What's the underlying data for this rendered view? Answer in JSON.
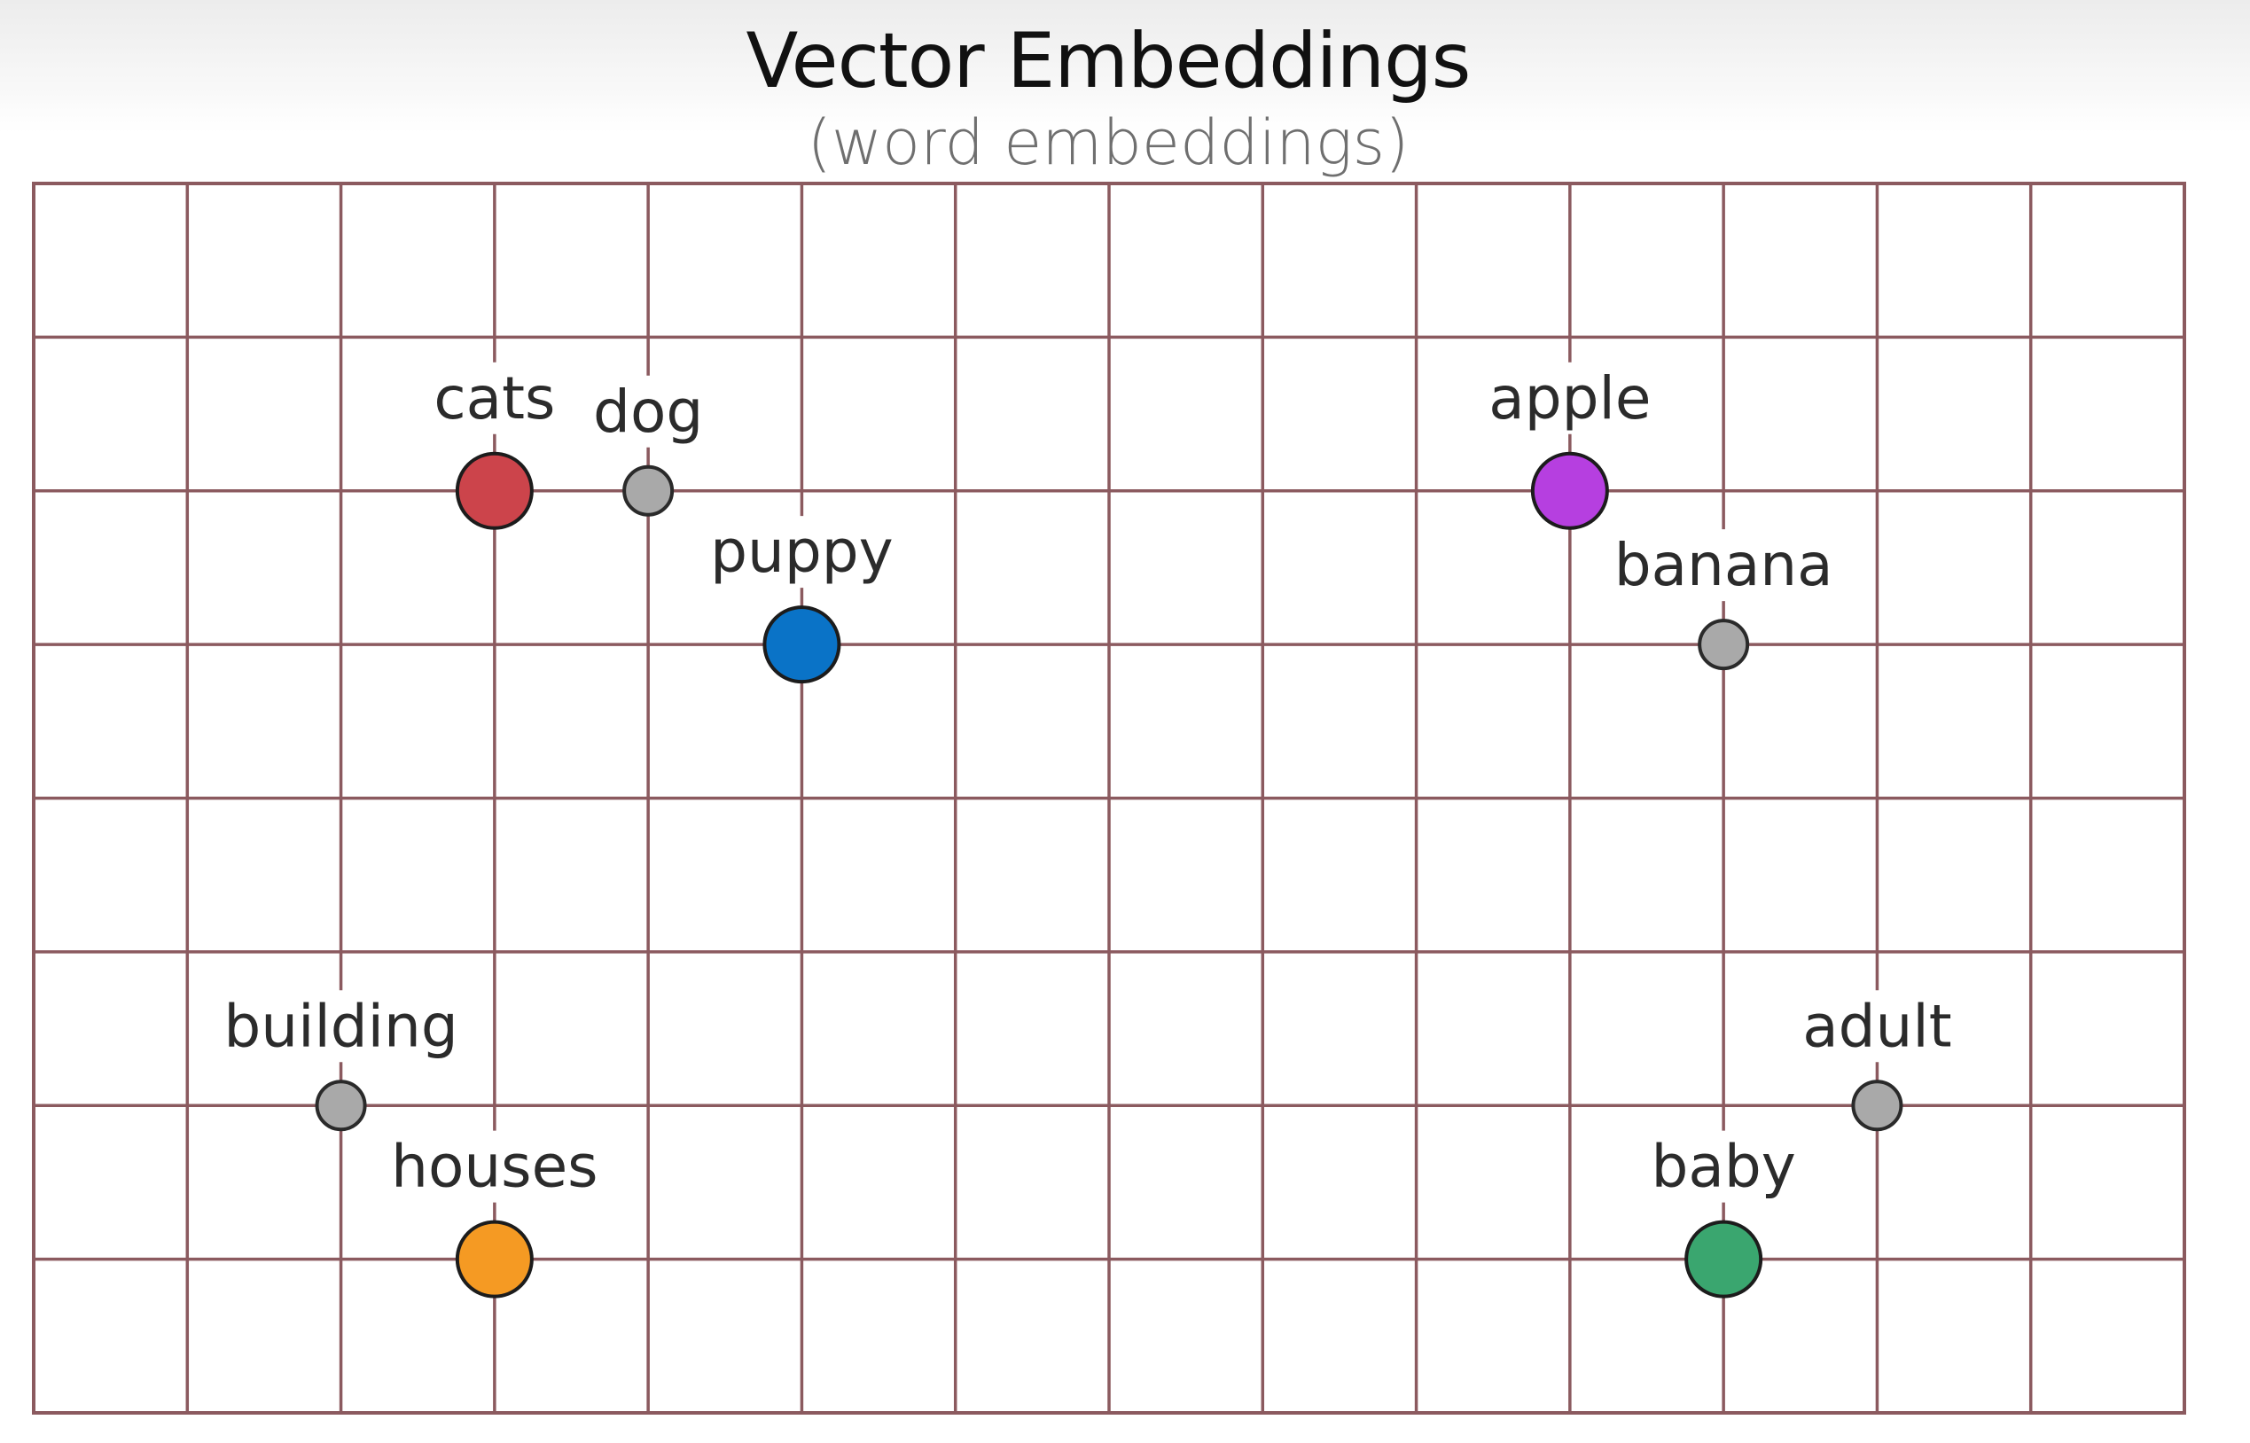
{
  "title": "Vector Embeddings",
  "subtitle": "(word embeddings)",
  "grid": {
    "columns": 14,
    "rows": 8,
    "line_color": "#8b5a5f",
    "background": "#ffffff"
  },
  "points": [
    {
      "id": "cats",
      "label": "cats",
      "col": 3,
      "row": 2,
      "size": "large",
      "color": "#cc444b",
      "stroke": "#1c1c1c"
    },
    {
      "id": "dog",
      "label": "dog",
      "col": 4,
      "row": 2,
      "size": "small",
      "color": "#a9a9a9",
      "stroke": "#2a2a2a"
    },
    {
      "id": "puppy",
      "label": "puppy",
      "col": 5,
      "row": 3,
      "size": "large",
      "color": "#0a73c7",
      "stroke": "#1c1c1c"
    },
    {
      "id": "apple",
      "label": "apple",
      "col": 10,
      "row": 2,
      "size": "large",
      "color": "#b63fe0",
      "stroke": "#1c1c1c"
    },
    {
      "id": "banana",
      "label": "banana",
      "col": 11,
      "row": 3,
      "size": "small",
      "color": "#a9a9a9",
      "stroke": "#2a2a2a"
    },
    {
      "id": "building",
      "label": "building",
      "col": 2,
      "row": 6,
      "size": "small",
      "color": "#a9a9a9",
      "stroke": "#2a2a2a"
    },
    {
      "id": "houses",
      "label": "houses",
      "col": 3,
      "row": 7,
      "size": "large",
      "color": "#f59a23",
      "stroke": "#1c1c1c"
    },
    {
      "id": "adult",
      "label": "adult",
      "col": 12,
      "row": 6,
      "size": "small",
      "color": "#a9a9a9",
      "stroke": "#2a2a2a"
    },
    {
      "id": "baby",
      "label": "baby",
      "col": 11,
      "row": 7,
      "size": "large",
      "color": "#3aa66f",
      "stroke": "#1c1c1c"
    }
  ]
}
